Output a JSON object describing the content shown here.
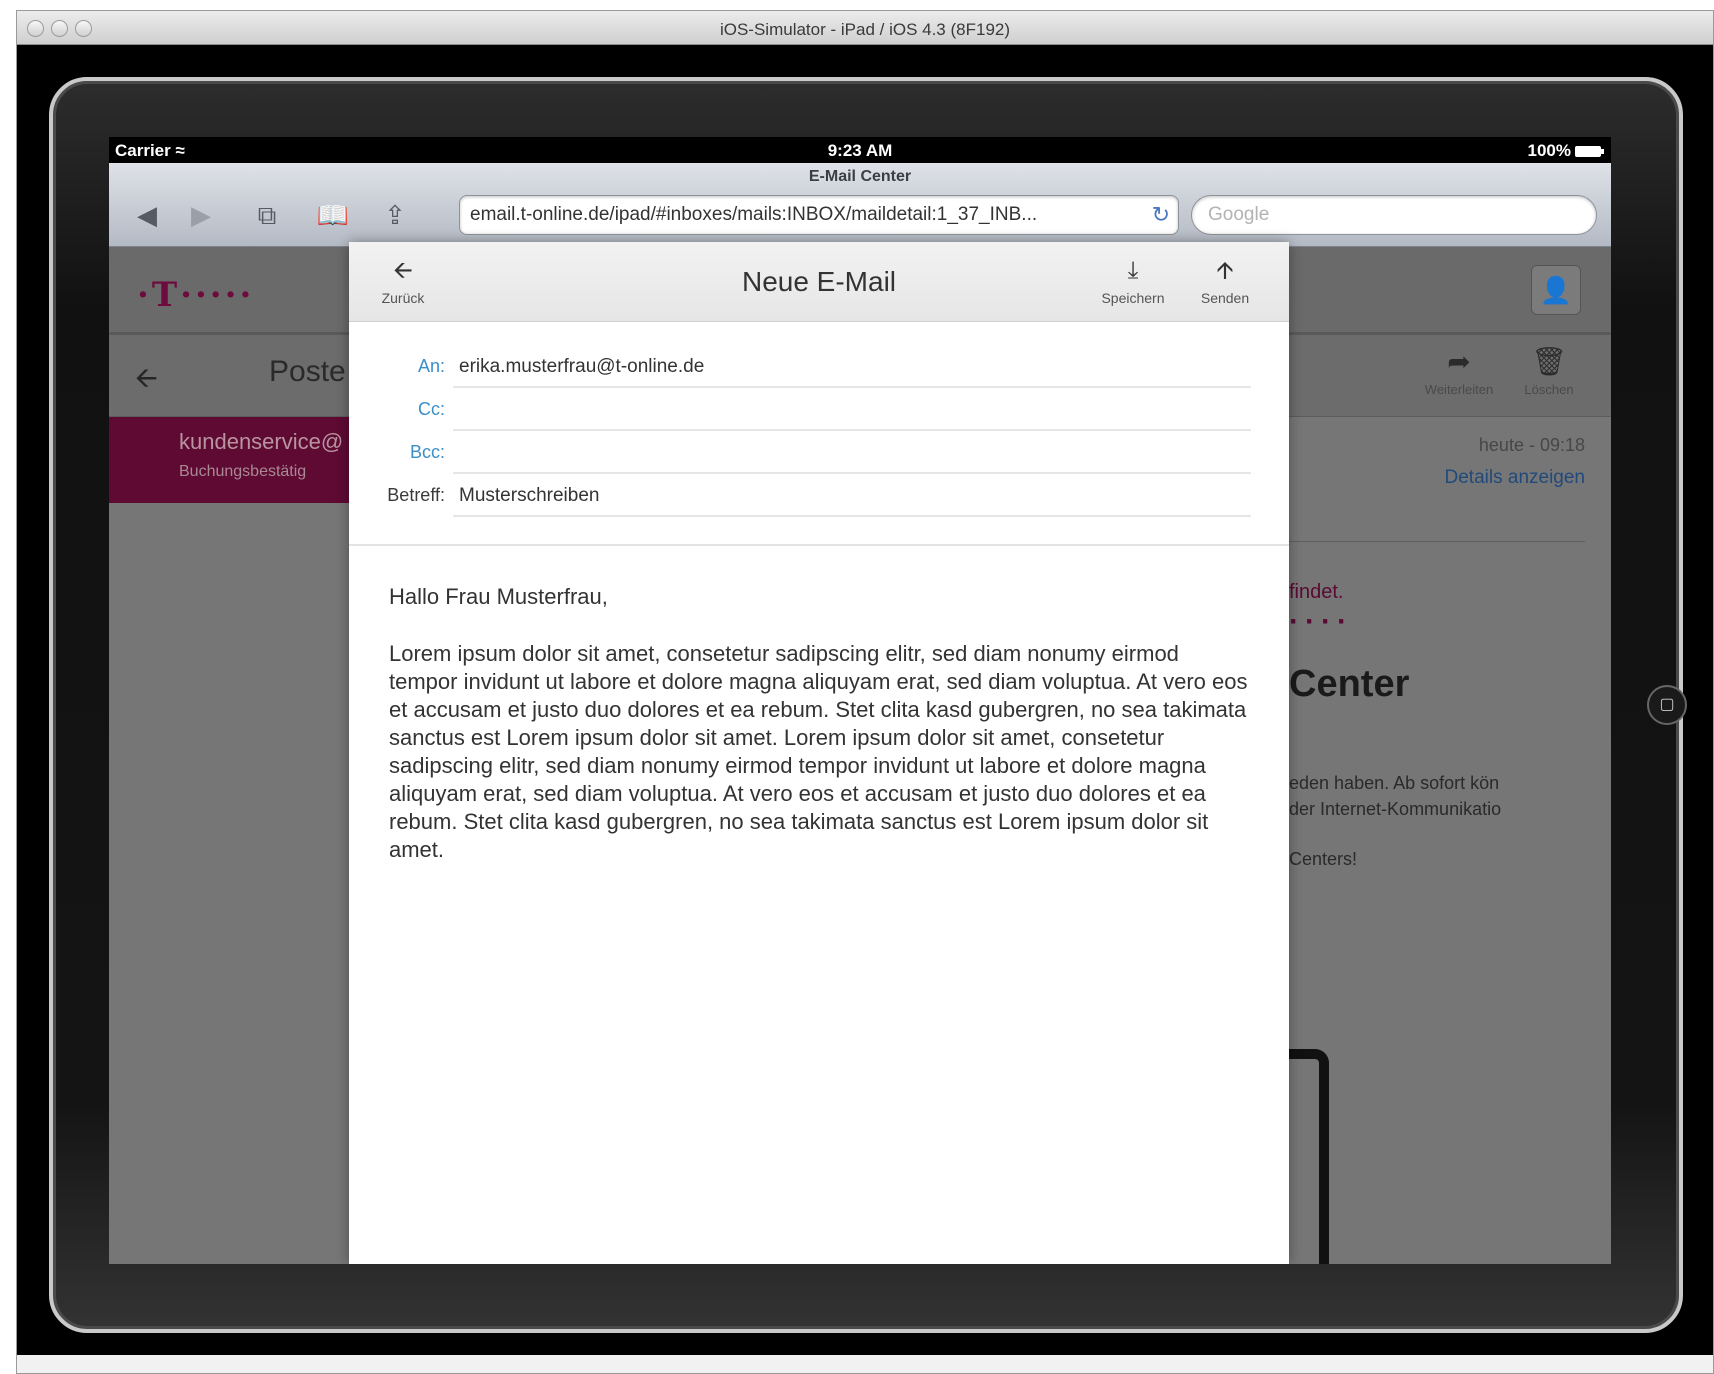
{
  "mac_window": {
    "title": "iOS-Simulator - iPad / iOS 4.3 (8F192)"
  },
  "status_bar": {
    "carrier": "Carrier",
    "time": "9:23 AM",
    "battery": "100%"
  },
  "safari": {
    "page_title": "E-Mail Center",
    "url": "email.t-online.de/ipad/#inboxes/mails:INBOX/maildetail:1_37_INB...",
    "search_placeholder": "Google"
  },
  "background_app": {
    "logo": "·T·····",
    "list_header": "Poste",
    "selected_mail": {
      "sender": "kundenservice@",
      "subject": "Buchungsbestätig"
    },
    "toolbar": {
      "forward_label": "Weiterleiten",
      "delete_label": "Löschen"
    },
    "mail_date": "heute - 09:18",
    "details_link": "Details anzeigen",
    "teaser_findet": "findet.",
    "teaser_title": "Center",
    "teaser_line1": "eden haben. Ab sofort kön",
    "teaser_line2": "der Internet-Kommunikatio",
    "teaser_centers": "Centers!"
  },
  "compose": {
    "title": "Neue E-Mail",
    "back_label": "Zurück",
    "save_label": "Speichern",
    "send_label": "Senden",
    "fields": {
      "to_label": "An:",
      "to_value": "erika.musterfrau@t-online.de",
      "cc_label": "Cc:",
      "cc_value": "",
      "bcc_label": "Bcc:",
      "bcc_value": "",
      "subject_label": "Betreff:",
      "subject_value": "Musterschreiben"
    },
    "greeting": "Hallo Frau Musterfrau,",
    "body": "Lorem ipsum dolor sit amet, consetetur sadipscing elitr, sed diam nonumy eirmod tempor invidunt ut labore et dolore magna aliquyam erat, sed diam voluptua. At vero eos et accusam et justo duo dolores et ea rebum. Stet clita kasd gubergren, no sea takimata sanctus est Lorem ipsum dolor sit amet. Lorem ipsum dolor sit amet, consetetur sadipscing elitr, sed diam nonumy eirmod tempor invidunt ut labore et dolore magna aliquyam erat, sed diam voluptua. At vero eos et accusam et justo duo dolores et ea rebum. Stet clita kasd gubergren, no sea takimata sanctus est Lorem ipsum dolor sit amet."
  },
  "colors": {
    "telekom_magenta": "#6d0b3e",
    "label_blue": "#3a8fc9",
    "link_blue": "#214a7a"
  },
  "icons": [
    "back-arrow-icon",
    "forward-arrow-icon",
    "tabs-icon",
    "bookmarks-icon",
    "share-icon",
    "reload-icon",
    "user-icon",
    "reply-arrow-icon",
    "trash-icon",
    "download-icon",
    "upload-icon",
    "wifi-icon",
    "battery-icon"
  ]
}
